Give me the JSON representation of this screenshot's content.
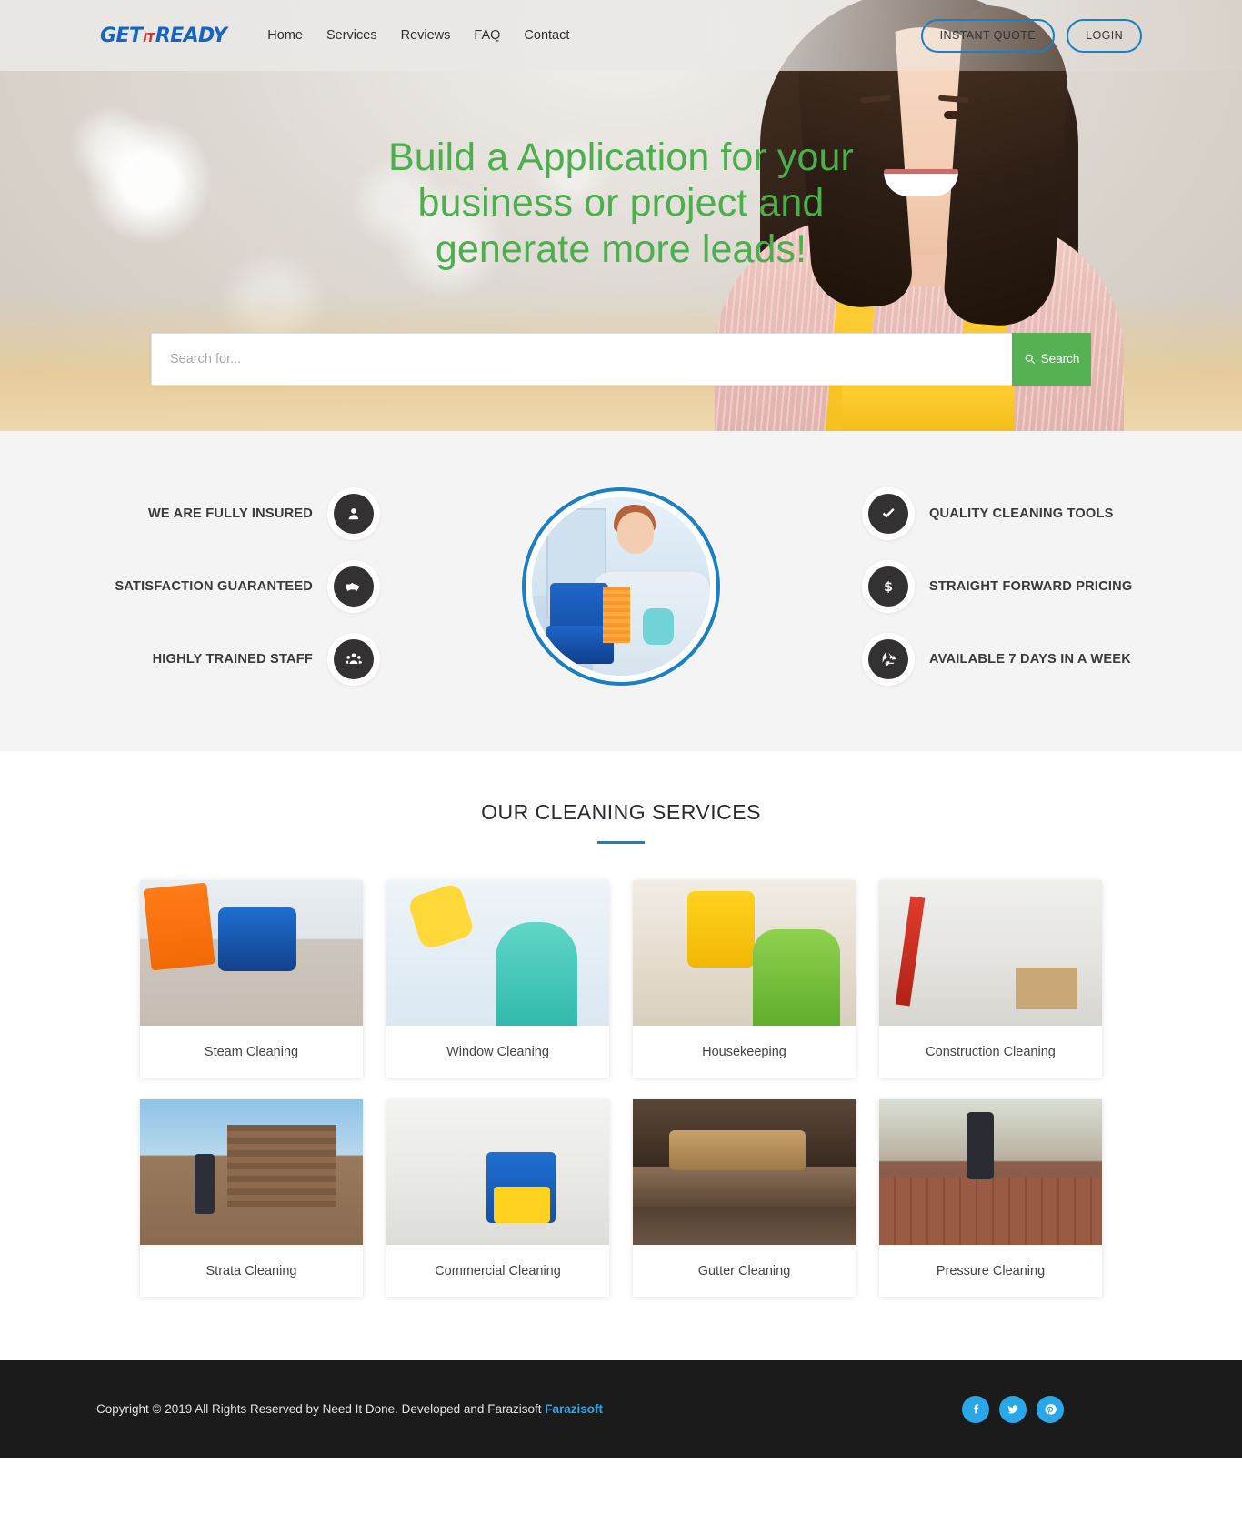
{
  "header": {
    "logo": {
      "part1": "GET",
      "part2": "IT",
      "part3": "READY"
    },
    "nav": [
      {
        "label": "Home"
      },
      {
        "label": "Services"
      },
      {
        "label": "Reviews"
      },
      {
        "label": "FAQ"
      },
      {
        "label": "Contact"
      }
    ],
    "instant_quote_label": "INSTANT QUOTE",
    "login_label": "LOGIN"
  },
  "hero": {
    "title": "Build a Application for your business or project and generate more leads!",
    "search_placeholder": "Search for...",
    "search_value": "",
    "search_button_label": "Search"
  },
  "features": {
    "left": [
      {
        "label": "WE ARE FULLY INSURED",
        "icon": "user-circle-icon"
      },
      {
        "label": "SATISFACTION GUARANTEED",
        "icon": "handshake-icon"
      },
      {
        "label": "HIGHLY TRAINED STAFF",
        "icon": "users-group-icon"
      }
    ],
    "right": [
      {
        "label": "QUALITY CLEANING TOOLS",
        "icon": "check-icon"
      },
      {
        "label": "STRAIGHT FORWARD PRICING",
        "icon": "dollar-icon"
      },
      {
        "label": "AVAILABLE 7 DAYS IN A WEEK",
        "icon": "recycle-icon"
      }
    ]
  },
  "services": {
    "title": "OUR CLEANING SERVICES",
    "cards": [
      {
        "label": "Steam Cleaning"
      },
      {
        "label": "Window Cleaning"
      },
      {
        "label": "Housekeeping"
      },
      {
        "label": "Construction Cleaning"
      },
      {
        "label": "Strata Cleaning"
      },
      {
        "label": "Commercial Cleaning"
      },
      {
        "label": "Gutter Cleaning"
      },
      {
        "label": "Pressure Cleaning"
      }
    ]
  },
  "footer": {
    "copyright": "Copyright © 2019 All Rights Reserved by Need It Done. Developed and Farazisoft ",
    "brand": "Farazisoft",
    "socials": [
      {
        "name": "facebook-icon"
      },
      {
        "name": "twitter-icon"
      },
      {
        "name": "pinterest-icon"
      }
    ]
  },
  "colors": {
    "accent_green": "#55b253",
    "accent_blue": "#1b7fc4",
    "logo_blue": "#1565c0",
    "logo_red": "#d32f2f",
    "footer_bg": "#1b1b1b",
    "social_blue": "#29a7e8"
  }
}
